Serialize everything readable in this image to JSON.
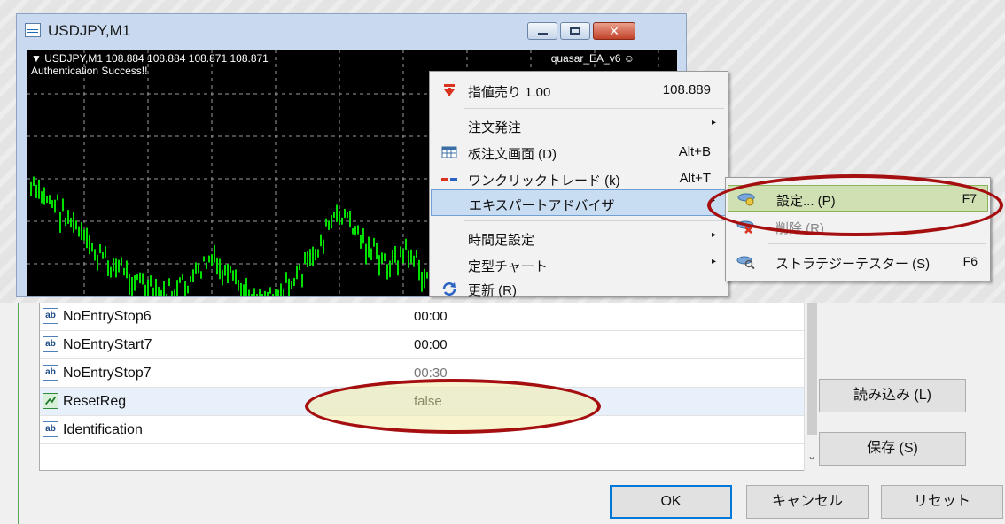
{
  "terminal_window": {
    "title": "USDJPY,M1",
    "chart": {
      "info_line": "▼ USDJPY,M1  108.884 108.884 108.871 108.871",
      "status_line": "Authentication Success!!",
      "ea_label": "quasar_EA_v6 ☺"
    },
    "close_glyph": "✕"
  },
  "context_menu": {
    "items": [
      {
        "label": "指値売り 1.00",
        "shortcut": "108.889",
        "icon": "sell-arrow-icon"
      },
      {
        "label": "注文発注",
        "shortcut": "▸"
      },
      {
        "label": "板注文画面 (D)",
        "shortcut": "Alt+B",
        "icon": "order-board-icon"
      },
      {
        "label": "ワンクリックトレード (k)",
        "shortcut": "Alt+T",
        "icon": "one-click-icon"
      },
      {
        "label": "エキスパートアドバイザ",
        "shortcut": "▸"
      },
      {
        "label": "時間足設定",
        "shortcut": "▸"
      },
      {
        "label": "定型チャート",
        "shortcut": "▸"
      },
      {
        "label": "更新 (R)",
        "icon": "refresh-icon"
      }
    ]
  },
  "expert_submenu": {
    "items": [
      {
        "label": "設定... (P)",
        "shortcut": "F7",
        "icon": "ea-settings-icon"
      },
      {
        "label": "削除 (R)",
        "icon": "ea-remove-icon"
      },
      {
        "label": "ストラテジーテスター (S)",
        "shortcut": "F6",
        "icon": "strategy-tester-icon"
      }
    ]
  },
  "parameters": {
    "rows": [
      {
        "name": "NoEntryStop6",
        "value": "00:00",
        "type": "ab"
      },
      {
        "name": "NoEntryStart7",
        "value": "00:00",
        "type": "ab"
      },
      {
        "name": "NoEntryStop7",
        "value": "00:30",
        "type": "ab"
      },
      {
        "name": "ResetReg",
        "value": "false",
        "type": "bool"
      },
      {
        "name": "Identification",
        "value": "",
        "type": "ab"
      }
    ],
    "icon_text": "ab",
    "scroll_down": "⌄"
  },
  "buttons": {
    "load": "読み込み (L)",
    "save": "保存 (S)",
    "ok": "OK",
    "cancel": "キャンセル",
    "reset": "リセット"
  },
  "colors": {
    "candles": "#00e000",
    "highlight_oval": "#a60f0f"
  }
}
